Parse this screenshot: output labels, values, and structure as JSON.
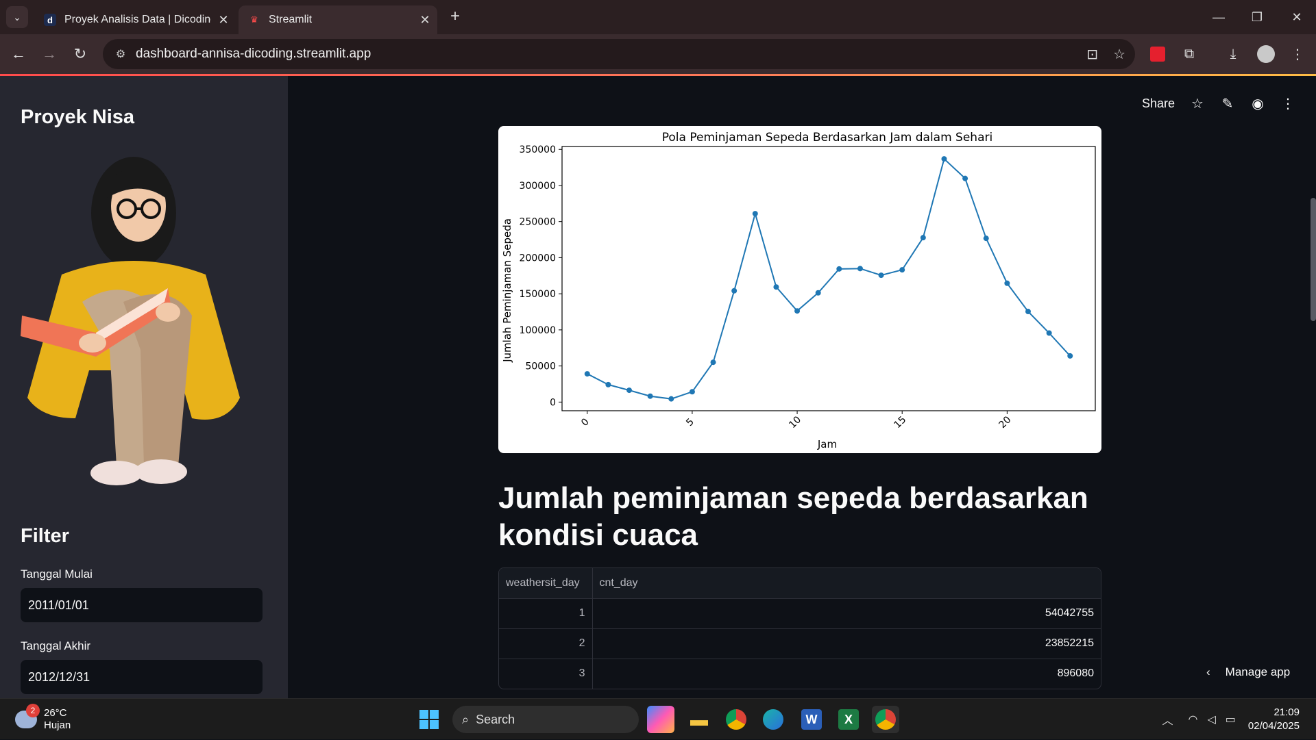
{
  "browser": {
    "tabs": [
      {
        "title": "Proyek Analisis Data | Dicoding",
        "favicon": "dicoding-icon",
        "active": false
      },
      {
        "title": "Streamlit",
        "favicon": "streamlit-icon",
        "active": true
      }
    ],
    "url": "dashboard-annisa-dicoding.streamlit.app"
  },
  "sidebar": {
    "title": "Proyek Nisa",
    "filter_title": "Filter",
    "start_label": "Tanggal Mulai",
    "start_value": "2011/01/01",
    "end_label": "Tanggal Akhir",
    "end_value": "2012/12/31"
  },
  "header": {
    "share_label": "Share"
  },
  "chart_data": {
    "type": "line",
    "title": "Pola Peminjaman Sepeda Berdasarkan Jam dalam Sehari",
    "xlabel": "Jam",
    "ylabel": "Jumlah Peminjaman Sepeda",
    "x": [
      0,
      1,
      2,
      3,
      4,
      5,
      6,
      7,
      8,
      9,
      10,
      11,
      12,
      13,
      14,
      15,
      16,
      17,
      18,
      19,
      20,
      21,
      22,
      23
    ],
    "values": [
      39130,
      24164,
      16352,
      8174,
      4428,
      14261,
      55132,
      154171,
      261001,
      159438,
      126257,
      151320,
      184414,
      184919,
      175652,
      183149,
      227748,
      336860,
      309772,
      226789,
      164550,
      125445,
      95612,
      63941
    ],
    "xticks": [
      0,
      5,
      10,
      15,
      20
    ],
    "yticks": [
      0,
      50000,
      100000,
      150000,
      200000,
      250000,
      300000,
      350000
    ],
    "xlim": [
      -1.2,
      24.2
    ],
    "ylim": [
      -12000,
      354000
    ],
    "color": "#1f77b4"
  },
  "section": {
    "heading": "Jumlah peminjaman sepeda berdasarkan kondisi cuaca"
  },
  "table": {
    "columns": [
      "weathersit_day",
      "cnt_day"
    ],
    "rows": [
      {
        "weathersit_day": "1",
        "cnt_day": "54042755"
      },
      {
        "weathersit_day": "2",
        "cnt_day": "23852215"
      },
      {
        "weathersit_day": "3",
        "cnt_day": "896080"
      }
    ]
  },
  "manage_app_label": "Manage app",
  "taskbar": {
    "temperature": "26°C",
    "weather": "Hujan",
    "weather_badge": "2",
    "search_label": "Search",
    "time": "21:09",
    "date": "02/04/2025"
  }
}
